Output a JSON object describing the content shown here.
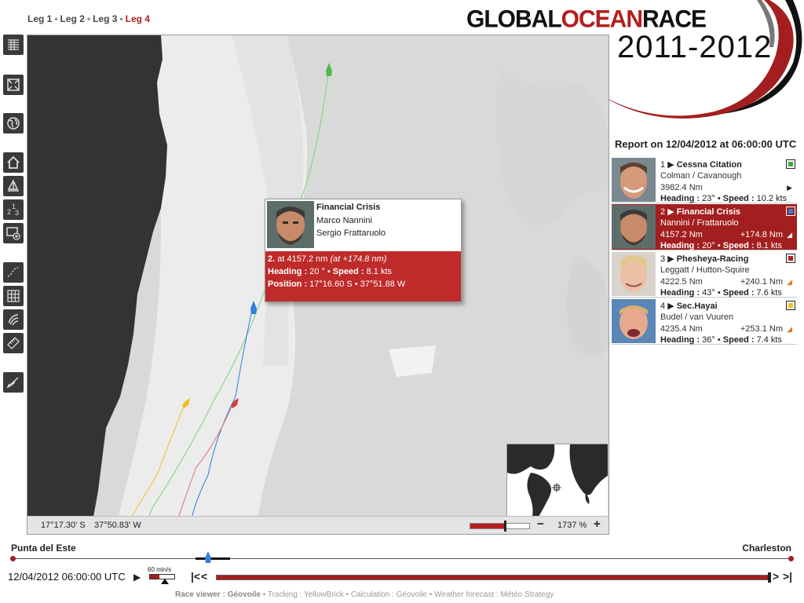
{
  "legs": {
    "leg1": "Leg 1",
    "leg2": "Leg 2",
    "leg3": "Leg 3",
    "leg4": "Leg 4",
    "sep": "•"
  },
  "logo": {
    "part1": "GLOBAL",
    "part2": "OCEAN",
    "part3": "RACE",
    "year": "2011-2012"
  },
  "toolbar": [
    "list-icon",
    "fullscreen-icon",
    "globe-icon",
    "home-icon",
    "boat-icon",
    "ranking-icon",
    "add-window-icon",
    "track-icon",
    "grid-icon",
    "weather-icon",
    "ruler-icon",
    "wind-icon"
  ],
  "map": {
    "lat": "17°17.30' S",
    "lon": "37°50.83' W",
    "zoom_minus": "−",
    "zoom_value": "1737 %",
    "zoom_plus": "+",
    "zoom_level": 0.58
  },
  "popup": {
    "boat_name": "Financial Crisis",
    "skipper1": "Marco Nannini",
    "skipper2": "Sergio Frattaruolo",
    "rank_line_a": "2.",
    "rank_line_b": " at 4157.2 nm ",
    "rank_line_c": "(at +174.8 nm)",
    "heading_label": "Heading :",
    "heading_value": " 20 ° • ",
    "speed_label": "Speed :",
    "speed_value": " 8.1 kts",
    "position_label": "Position :",
    "position_value": " 17°16.60 S • 37°51.88 W"
  },
  "report": "Report on 12/04/2012 at 06:00:00 UTC",
  "ranking": [
    {
      "pos": "1",
      "name": "Cessna Citation",
      "skippers": "Colman / Cavanough",
      "distance": "3982.4 Nm",
      "gap": "",
      "heading": " 23° • ",
      "speed": " 10.2 kts",
      "color": "#3caa3c",
      "trend": "▶"
    },
    {
      "pos": "2",
      "name": "Financial Crisis",
      "skippers": "Nannini / Frattaruolo",
      "distance": "4157.2 Nm",
      "gap": "+174.8 Nm",
      "heading": " 20° • ",
      "speed": " 8.1 kts",
      "color": "#2f7fe0",
      "trend": "◢"
    },
    {
      "pos": "3",
      "name": "Phesheya-Racing",
      "skippers": "Leggatt / Hutton-Squire",
      "distance": "4222.5 Nm",
      "gap": "+240.1 Nm",
      "heading": " 43° • ",
      "speed": " 7.6 kts",
      "color": "#b41e1e",
      "trend": "◢"
    },
    {
      "pos": "4",
      "name": "Sec.Hayai",
      "skippers": "Budel / van Vuuren",
      "distance": "4235.4 Nm",
      "gap": "+253.1 Nm",
      "heading": " 36° • ",
      "speed": " 7.4 kts",
      "color": "#f0c020",
      "trend": "◢"
    }
  ],
  "labels": {
    "pos_arrow": "▶",
    "heading": "Heading :",
    "speed": "Speed :"
  },
  "timeline": {
    "start": "Punta del Este",
    "end": "Charleston",
    "datetime": "12/04/2012 06:00:00 UTC",
    "play": "▶",
    "speed": "60 min/s",
    "rew1": "|<",
    "rew2": "<",
    "ff1": ">",
    "ff2": ">|"
  },
  "credits": {
    "viewer_label": "Race viewer : ",
    "viewer_value": "Géovoile",
    "sep": " • ",
    "tracking": "Tracking : YellowBrick",
    "calculation": "Calculation : Géovoile",
    "weather": "Weather forecast : Météo Strategy"
  }
}
